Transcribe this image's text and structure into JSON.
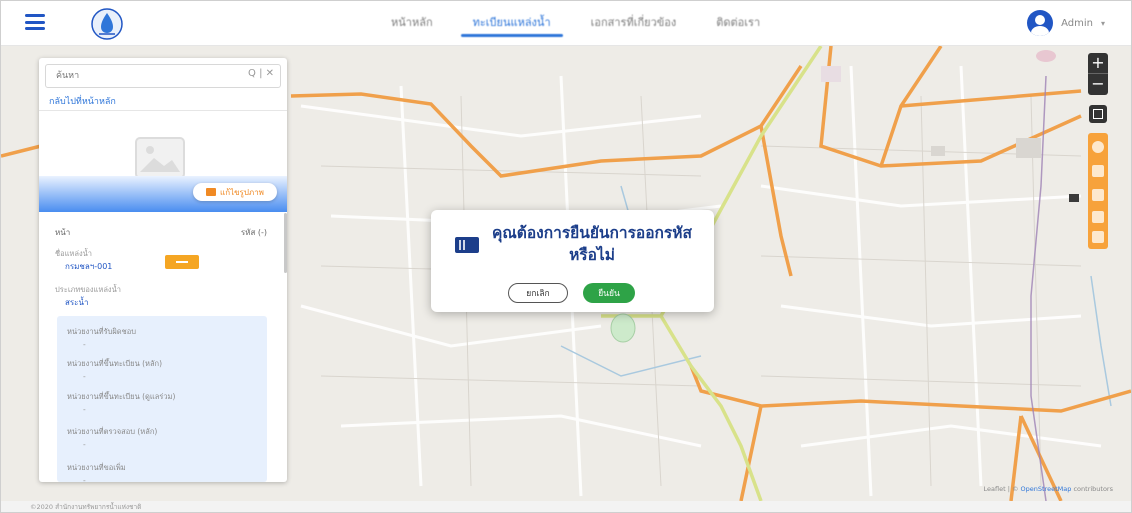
{
  "header": {
    "nav": [
      {
        "label": "หน้าหลัก",
        "active": false
      },
      {
        "label": "ทะเบียนแหล่งน้ำ",
        "active": true
      },
      {
        "label": "เอกสารที่เกี่ยวข้อง",
        "active": false
      },
      {
        "label": "ติดต่อเรา",
        "active": false
      }
    ],
    "user": {
      "name": "Admin"
    },
    "accent_color": "#2f76d9"
  },
  "panel": {
    "search_placeholder": "ค้นหา",
    "search_tools": "Q | ✕",
    "back_link": "กลับไปที่หน้าหลัก",
    "edit_image_button": "แก้ไขรูปภาพ",
    "code_label": "หน้า",
    "code_value": "รหัส (-)",
    "fields": [
      {
        "label": "ชื่อแหล่งน้ำ",
        "value": "กรมชลฯ-001"
      },
      {
        "label": "ประเภทของแหล่งน้ำ",
        "value": "สระน้ำ"
      }
    ],
    "details": [
      {
        "label": "หน่วยงานที่รับผิดชอบ",
        "value": "-"
      },
      {
        "label": "หน่วยงานที่ขึ้นทะเบียน (หลัก)",
        "value": "-"
      },
      {
        "label": "หน่วยงานที่ขึ้นทะเบียน (ดูแลร่วม)",
        "value": "-"
      },
      {
        "label": "หน่วยงานที่ตรวจสอบ (หลัก)",
        "value": "-"
      },
      {
        "label": "หน่วยงานที่ขอเพิ่ม",
        "value": "-"
      }
    ]
  },
  "map": {
    "attribution_prefix": "Leaflet | ©",
    "attribution_link": "OpenStreetMap",
    "attribution_suffix": "contributors"
  },
  "modal": {
    "title": "คุณต้องการยืนยันการออกรหัสหรือไม่",
    "cancel": "ยกเลิก",
    "confirm": "ยืนยัน",
    "confirm_color": "#2ea347",
    "icon": "id-card-icon"
  },
  "footer": "©2020 สำนักงานทรัพยากรน้ำแห่งชาติ"
}
